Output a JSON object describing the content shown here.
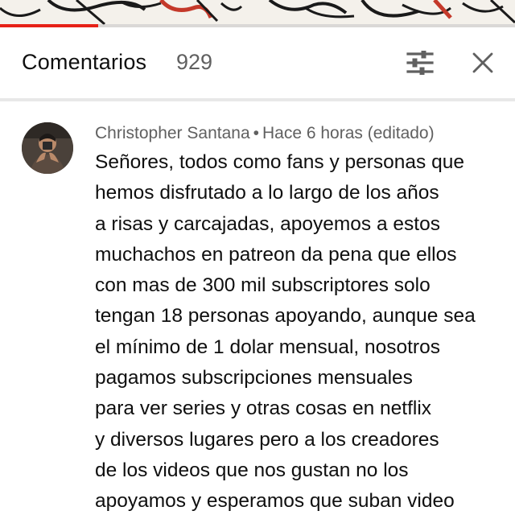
{
  "video": {
    "progress_fraction": 0.19,
    "progress_color": "#e62117"
  },
  "header": {
    "title": "Comentarios",
    "count": "929",
    "sort_icon": "sort-filter-icon",
    "close_icon": "close-icon"
  },
  "comment": {
    "author": "Christopher Santana",
    "separator": "•",
    "time": "Hace 6 horas (editado)",
    "lines": [
      "Señores, todos como fans y personas que",
      "hemos disfrutado a lo largo de los años",
      "a risas y carcajadas, apoyemos a estos",
      "muchachos en patreon da pena que ellos",
      "con mas de 300 mil subscriptores solo",
      "tengan 18 personas apoyando, aunque sea",
      "el mínimo de 1 dolar mensual, nosotros",
      "pagamos subscripciones mensuales",
      "para ver series y otras cosas en netflix",
      "y diversos lugares pero a los creadores",
      "de los videos que nos gustan no los",
      "apoyamos y esperamos que suban video"
    ]
  }
}
